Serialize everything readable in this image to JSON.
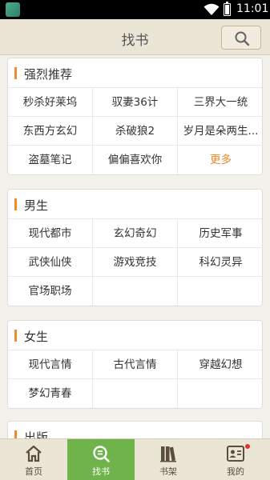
{
  "status_bar": {
    "time": "11:01"
  },
  "header": {
    "title": "找书"
  },
  "sections": [
    {
      "title": "强烈推荐",
      "items": [
        "秒杀好莱坞",
        "驭妻36计",
        "三界大一统",
        "东西方玄幻",
        "杀破狼2",
        "岁月是朵两生...",
        "盗墓笔记",
        "偏偏喜欢你",
        "更多"
      ]
    },
    {
      "title": "男生",
      "items": [
        "现代都市",
        "玄幻奇幻",
        "历史军事",
        "武侠仙侠",
        "游戏竞技",
        "科幻灵异",
        "官场职场"
      ]
    },
    {
      "title": "女生",
      "items": [
        "现代言情",
        "古代言情",
        "穿越幻想",
        "梦幻青春"
      ]
    },
    {
      "title": "出版",
      "items": []
    }
  ],
  "bottom_nav": {
    "home": "首页",
    "find": "找书",
    "shelf": "书架",
    "mine": "我的"
  },
  "colors": {
    "accent": "#f08a2c",
    "active_tab": "#6fb44a",
    "more_link": "#e8892b"
  }
}
